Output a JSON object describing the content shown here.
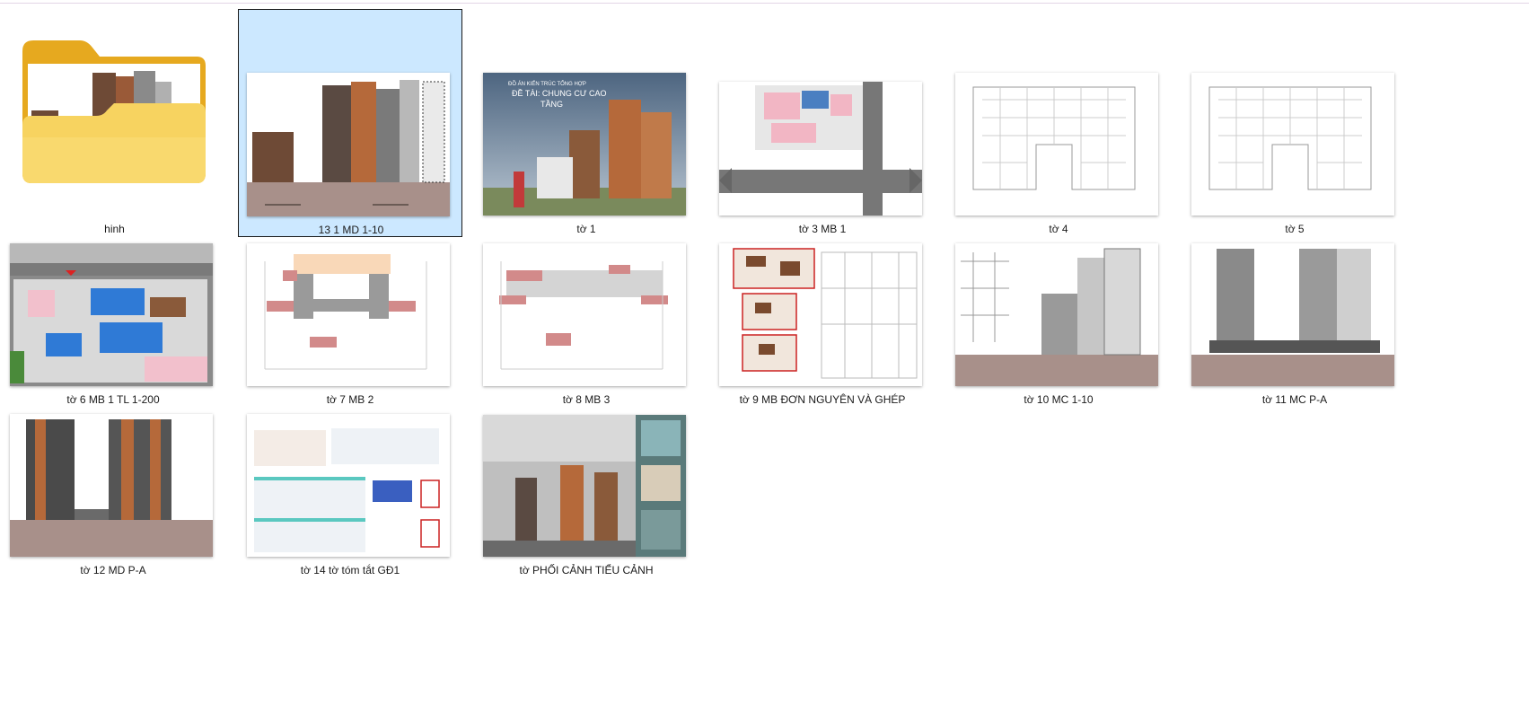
{
  "items": [
    {
      "name": "hinh",
      "type": "folder"
    },
    {
      "name": "13 1 MD 1-10",
      "type": "image",
      "selected": true
    },
    {
      "name": "tờ 1",
      "type": "image"
    },
    {
      "name": "tờ 3 MB 1",
      "type": "image"
    },
    {
      "name": "tờ 4",
      "type": "image"
    },
    {
      "name": "tờ 5",
      "type": "image"
    },
    {
      "name": "tờ 6 MB 1 TL 1-200",
      "type": "image"
    },
    {
      "name": "tờ 7 MB 2",
      "type": "image"
    },
    {
      "name": "tờ 8 MB 3",
      "type": "image"
    },
    {
      "name": "tờ 9 MB ĐƠN NGUYÊN VÀ GHÉP",
      "type": "image"
    },
    {
      "name": "tờ 10 MC 1-10",
      "type": "image"
    },
    {
      "name": "tờ 11 MC P-A",
      "type": "image"
    },
    {
      "name": "tờ 12 MD P-A",
      "type": "image"
    },
    {
      "name": "tờ 14 tờ tóm tắt GĐ1",
      "type": "image"
    },
    {
      "name": "tờ PHỐI CẢNH TIỂU CẢNH",
      "type": "image"
    }
  ],
  "cover_text": {
    "line1": "ĐỒ ÁN KIẾN TRÚC TỔNG HỢP",
    "line2": "ĐỀ TÀI: CHUNG CƯ CAO",
    "line3": "TẦNG"
  },
  "colors": {
    "selection_bg": "#cce8ff",
    "folder_body": "#f7c948",
    "brick": "#b5693a",
    "ground": "#a8908a"
  }
}
